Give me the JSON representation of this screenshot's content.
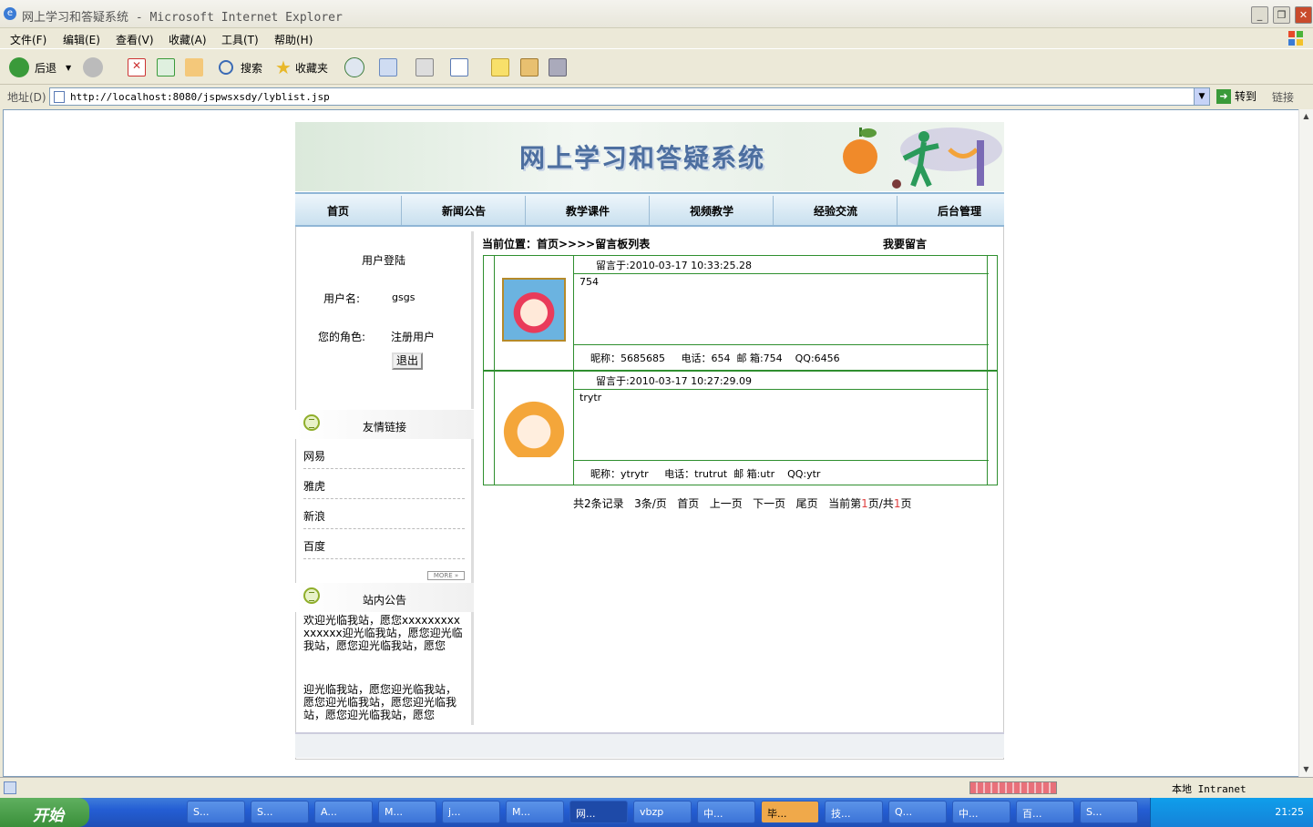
{
  "window": {
    "title": "网上学习和答疑系统 - Microsoft Internet Explorer"
  },
  "menu": [
    "文件(F)",
    "编辑(E)",
    "查看(V)",
    "收藏(A)",
    "工具(T)",
    "帮助(H)"
  ],
  "toolbar": {
    "back": "后退",
    "search": "搜索",
    "favorites": "收藏夹"
  },
  "address": {
    "label": "地址(D)",
    "url": "http://localhost:8080/jspwsxsdy/lyblist.jsp",
    "go": "转到",
    "links": "链接"
  },
  "site": {
    "banner_title": "网上学习和答疑系统",
    "nav": [
      "首页",
      "新闻公告",
      "教学课件",
      "视频教学",
      "经验交流",
      "后台管理"
    ]
  },
  "login": {
    "title": "用户登陆",
    "username_label": "用户名:",
    "username": "gsgs",
    "role_label": "您的角色:",
    "role": "注册用户",
    "logout": "退出"
  },
  "links_section": {
    "title": "友情链接",
    "items": [
      "网易",
      "雅虎",
      "新浪",
      "百度"
    ],
    "more": "MORE »"
  },
  "notice_section": {
    "title": "站内公告",
    "text1": "欢迎光临我站，愿您xxxxxxxxxxxxxxx迎光临我站，愿您迎光临我站，愿您迎光临我站，愿您",
    "text2": "迎光临我站，愿您迎光临我站，愿您迎光临我站，愿您迎光临我站，愿您迎光临我站，愿您"
  },
  "main": {
    "breadcrumb": "当前位置：首页>>>>留言板列表",
    "write": "我要留言",
    "messages": [
      {
        "time": "留言于:2010-03-17 10:33:25.28",
        "content": "754",
        "footer": "昵称：5685685     电话：654  邮 箱:754    QQ:6456"
      },
      {
        "time": "留言于:2010-03-17 10:27:29.09",
        "content": "trytr",
        "footer": "昵称：ytrytr     电话：trutrut  邮 箱:utr    QQ:ytr"
      }
    ],
    "pager": {
      "total": "共2条记录",
      "per": "3条/页",
      "first": "首页",
      "prev": "上一页",
      "next": "下一页",
      "last": "尾页",
      "current_pre": "当前第",
      "current": "1",
      "current_mid": "页/共",
      "pages": "1",
      "current_post": "页"
    }
  },
  "status": {
    "zone": "本地 Intranet"
  },
  "taskbar": {
    "start": "开始",
    "items": [
      "S...",
      "S...",
      "A...",
      "M...",
      "j...",
      "M...",
      "网...",
      "vbzp",
      "中...",
      "毕...",
      "技...",
      "Q...",
      "中...",
      "百...",
      "S..."
    ],
    "clock": "21:25"
  }
}
